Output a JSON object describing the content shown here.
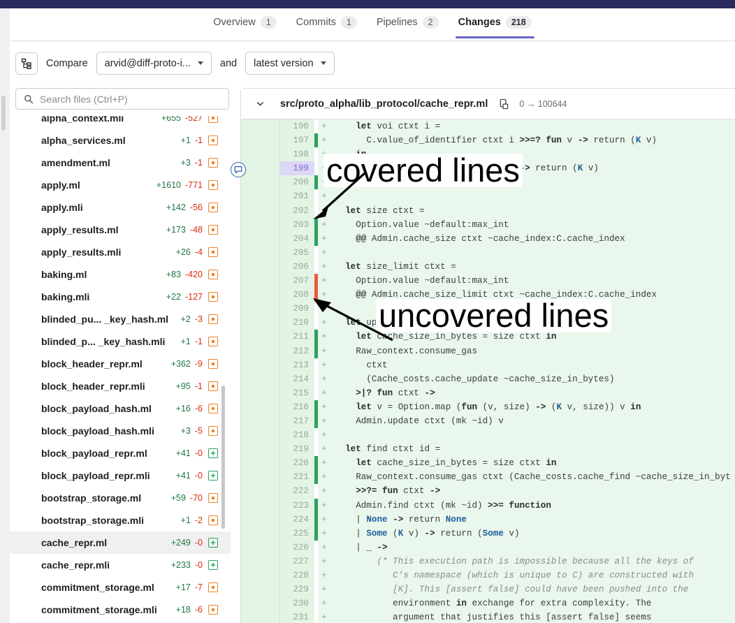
{
  "topbar": {
    "color": "#2b2b5e"
  },
  "tabs": [
    {
      "label": "Overview",
      "count": "1",
      "active": false
    },
    {
      "label": "Commits",
      "count": "1",
      "active": false
    },
    {
      "label": "Pipelines",
      "count": "2",
      "active": false
    },
    {
      "label": "Changes",
      "count": "218",
      "active": true
    }
  ],
  "compare": {
    "tree_icon": "file-tree-icon",
    "label": "Compare",
    "source": "arvid@diff-proto-i...",
    "conjunction": "and",
    "target": "latest version"
  },
  "search": {
    "placeholder": "Search files (Ctrl+P)",
    "value": "",
    "icon": "search-icon"
  },
  "files": [
    {
      "name": "alpha_context.mli",
      "add": "+655",
      "del": "-527",
      "status": "modified"
    },
    {
      "name": "alpha_services.ml",
      "add": "+1",
      "del": "-1",
      "status": "modified"
    },
    {
      "name": "amendment.ml",
      "add": "+3",
      "del": "-1",
      "status": "modified"
    },
    {
      "name": "apply.ml",
      "add": "+1610",
      "del": "-771",
      "status": "modified"
    },
    {
      "name": "apply.mli",
      "add": "+142",
      "del": "-56",
      "status": "modified"
    },
    {
      "name": "apply_results.ml",
      "add": "+173",
      "del": "-48",
      "status": "modified"
    },
    {
      "name": "apply_results.mli",
      "add": "+26",
      "del": "-4",
      "status": "modified"
    },
    {
      "name": "baking.ml",
      "add": "+83",
      "del": "-420",
      "status": "modified"
    },
    {
      "name": "baking.mli",
      "add": "+22",
      "del": "-127",
      "status": "modified"
    },
    {
      "name": "blinded_pu... _key_hash.ml",
      "add": "+2",
      "del": "-3",
      "status": "modified"
    },
    {
      "name": "blinded_p... _key_hash.mli",
      "add": "+1",
      "del": "-1",
      "status": "modified"
    },
    {
      "name": "block_header_repr.ml",
      "add": "+362",
      "del": "-9",
      "status": "modified"
    },
    {
      "name": "block_header_repr.mli",
      "add": "+95",
      "del": "-1",
      "status": "modified"
    },
    {
      "name": "block_payload_hash.ml",
      "add": "+16",
      "del": "-6",
      "status": "modified"
    },
    {
      "name": "block_payload_hash.mli",
      "add": "+3",
      "del": "-5",
      "status": "modified"
    },
    {
      "name": "block_payload_repr.ml",
      "add": "+41",
      "del": "-0",
      "status": "added"
    },
    {
      "name": "block_payload_repr.mli",
      "add": "+41",
      "del": "-0",
      "status": "added"
    },
    {
      "name": "bootstrap_storage.ml",
      "add": "+59",
      "del": "-70",
      "status": "modified"
    },
    {
      "name": "bootstrap_storage.mli",
      "add": "+1",
      "del": "-2",
      "status": "modified"
    },
    {
      "name": "cache_repr.ml",
      "add": "+249",
      "del": "-0",
      "status": "added",
      "selected": true
    },
    {
      "name": "cache_repr.mli",
      "add": "+233",
      "del": "-0",
      "status": "added"
    },
    {
      "name": "commitment_storage.ml",
      "add": "+17",
      "del": "-7",
      "status": "modified"
    },
    {
      "name": "commitment_storage.mli",
      "add": "+18",
      "del": "-6",
      "status": "modified"
    }
  ],
  "diff_header": {
    "chevron_icon": "chevron-down-icon",
    "path": "src/proto_alpha/lib_protocol/cache_repr.ml",
    "copy_icon": "copy-path-icon",
    "mode": "0 → 100644"
  },
  "comment_marker": {
    "icon": "comment-bubble-icon",
    "line": "199"
  },
  "annotations": [
    {
      "id": "covered",
      "text": "covered lines"
    },
    {
      "id": "uncovered",
      "text": "uncovered lines"
    }
  ],
  "diff_lines": [
    {
      "n": "196",
      "sign": "+",
      "cov": "none",
      "code": "    let voi ctxt i ="
    },
    {
      "n": "197",
      "sign": "+",
      "cov": "green",
      "code": "      C.value_of_identifier ctxt i >>=? fun v -> return (K v)"
    },
    {
      "n": "198",
      "sign": "+",
      "cov": "none",
      "code": "    in"
    },
    {
      "n": "199",
      "sign": "+",
      "cov": "none",
      "code": "    value_of_key ctxt k >>=? fun v -> return (K v)",
      "highlight": true
    },
    {
      "n": "200",
      "sign": "+",
      "cov": "green",
      "code": "      Na             _key_handlers"
    },
    {
      "n": "201",
      "sign": "+",
      "cov": "none",
      "code": ""
    },
    {
      "n": "202",
      "sign": "+",
      "cov": "none",
      "code": "  let size ctxt ="
    },
    {
      "n": "203",
      "sign": "+",
      "cov": "green",
      "code": "    Option.value ~default:max_int"
    },
    {
      "n": "204",
      "sign": "+",
      "cov": "green",
      "code": "    @@ Admin.cache_size ctxt ~cache_index:C.cache_index"
    },
    {
      "n": "205",
      "sign": "+",
      "cov": "none",
      "code": ""
    },
    {
      "n": "206",
      "sign": "+",
      "cov": "none",
      "code": "  let size_limit ctxt ="
    },
    {
      "n": "207",
      "sign": "+",
      "cov": "red",
      "code": "    Option.value ~default:max_int"
    },
    {
      "n": "208",
      "sign": "+",
      "cov": "red",
      "code": "    @@ Admin.cache_size_limit ctxt ~cache_index:C.cache_index"
    },
    {
      "n": "209",
      "sign": "+",
      "cov": "none",
      "code": ""
    },
    {
      "n": "210",
      "sign": "+",
      "cov": "none",
      "code": "  let update ctxt id v ="
    },
    {
      "n": "211",
      "sign": "+",
      "cov": "green",
      "code": "    let cache_size_in_bytes = size ctxt in"
    },
    {
      "n": "212",
      "sign": "+",
      "cov": "green",
      "code": "    Raw_context.consume_gas"
    },
    {
      "n": "213",
      "sign": "+",
      "cov": "none",
      "code": "      ctxt"
    },
    {
      "n": "214",
      "sign": "+",
      "cov": "none",
      "code": "      (Cache_costs.cache_update ~cache_size_in_bytes)"
    },
    {
      "n": "215",
      "sign": "+",
      "cov": "none",
      "code": "    >|? fun ctxt ->"
    },
    {
      "n": "216",
      "sign": "+",
      "cov": "green",
      "code": "    let v = Option.map (fun (v, size) -> (K v, size)) v in"
    },
    {
      "n": "217",
      "sign": "+",
      "cov": "green",
      "code": "    Admin.update ctxt (mk ~id) v"
    },
    {
      "n": "218",
      "sign": "+",
      "cov": "none",
      "code": ""
    },
    {
      "n": "219",
      "sign": "+",
      "cov": "none",
      "code": "  let find ctxt id ="
    },
    {
      "n": "220",
      "sign": "+",
      "cov": "green",
      "code": "    let cache_size_in_bytes = size ctxt in"
    },
    {
      "n": "221",
      "sign": "+",
      "cov": "green",
      "code": "    Raw_context.consume_gas ctxt (Cache_costs.cache_find ~cache_size_in_byt"
    },
    {
      "n": "222",
      "sign": "+",
      "cov": "none",
      "code": "    >>?= fun ctxt ->"
    },
    {
      "n": "223",
      "sign": "+",
      "cov": "green",
      "code": "    Admin.find ctxt (mk ~id) >>= function"
    },
    {
      "n": "224",
      "sign": "+",
      "cov": "green",
      "code": "    | None -> return None"
    },
    {
      "n": "225",
      "sign": "+",
      "cov": "green",
      "code": "    | Some (K v) -> return (Some v)"
    },
    {
      "n": "226",
      "sign": "+",
      "cov": "none",
      "code": "    | _ ->"
    },
    {
      "n": "227",
      "sign": "+",
      "cov": "none",
      "code": "        (* This execution path is impossible because all the keys of"
    },
    {
      "n": "228",
      "sign": "+",
      "cov": "none",
      "code": "           C's namespace (which is unique to C) are constructed with"
    },
    {
      "n": "229",
      "sign": "+",
      "cov": "none",
      "code": "           [K]. This [assert false] could have been pushed into the"
    },
    {
      "n": "230",
      "sign": "+",
      "cov": "none",
      "code": "           environment in exchange for extra complexity. The"
    },
    {
      "n": "231",
      "sign": "+",
      "cov": "none",
      "code": "           argument that justifies this [assert false] seems"
    }
  ]
}
